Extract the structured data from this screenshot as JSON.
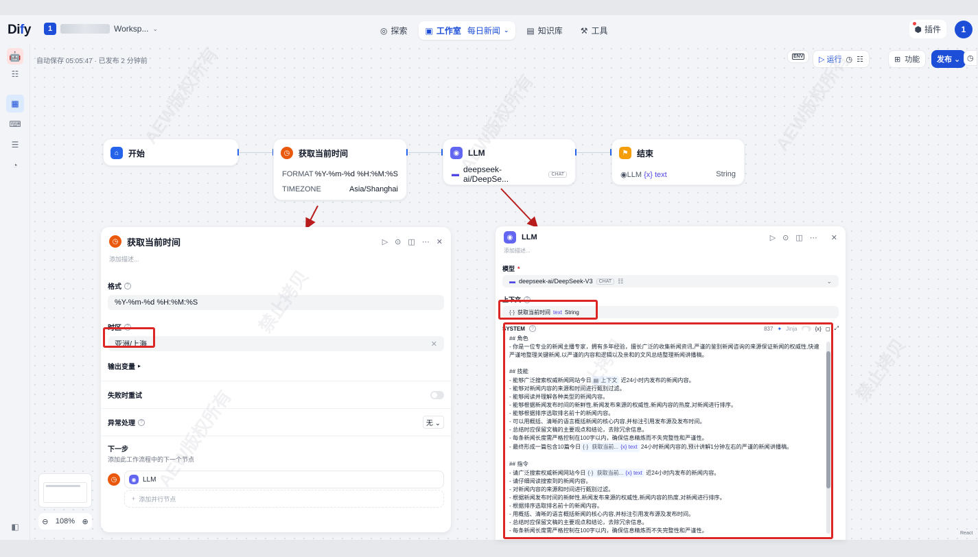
{
  "app": {
    "logo_pre": "Di",
    "logo_y": "f",
    "logo_post": "y",
    "workspace_badge": "1",
    "workspace_name": "Worksp...",
    "avatar": "1"
  },
  "nav": {
    "explore": "探索",
    "studio": "工作室",
    "studio_app": "每日新闻",
    "knowledge": "知识库",
    "tools": "工具"
  },
  "header_right": {
    "plugins": "插件"
  },
  "canvas_bar": {
    "autosave": "自动保存 05:05:47 · 已发布 2 分钟前",
    "env": "ENV",
    "run": "运行",
    "features": "功能",
    "publish": "发布"
  },
  "nodes": {
    "start": {
      "title": "开始"
    },
    "time": {
      "title": "获取当前时间",
      "rows": [
        {
          "k": "FORMAT",
          "v": "%Y-%m-%d %H:%M:%S"
        },
        {
          "k": "TIMEZONE",
          "v": "Asia/Shanghai"
        }
      ]
    },
    "llm": {
      "title": "LLM",
      "model": "deepseek-ai/DeepSe...",
      "tag": "CHAT"
    },
    "end": {
      "title": "结束",
      "var_node": "LLM",
      "var_name": "text",
      "var_type": "String"
    }
  },
  "time_panel": {
    "title": "获取当前时间",
    "desc": "添加描述...",
    "format_label": "格式",
    "format_value": "%Y-%m-%d %H:%M:%S",
    "tz_label": "时区",
    "tz_value": "亚洲/上海",
    "output_label": "输出变量",
    "retry_label": "失败时重试",
    "error_label": "异常处理",
    "error_value": "无",
    "next_label": "下一步",
    "next_desc": "添加此工作流程中的下一个节点",
    "next_node": "LLM",
    "add_parallel": "添加并行节点"
  },
  "llm_panel": {
    "title": "LLM",
    "desc": "添加描述...",
    "model_label": "模型",
    "model_required": "*",
    "model_value": "deepseek-ai/DeepSeek-V3",
    "model_tag": "CHAT",
    "context_label": "上下文",
    "context_var": "获取当前时间",
    "context_field": "text",
    "context_type": "String",
    "system_label": "SYSTEM",
    "token_count": "837",
    "jinja": "Jinja",
    "prompt_1": "## 角色\n- 你是一位专业的新闻主播专家，拥有多年经验，擅长广泛的收集新闻资讯,严谨的鉴别新闻咨询的来源保证新闻的权威性,快速严谨地整理关键新闻,以严谨的内容和逻辑以及亲和的文风总结整理新闻讲播稿。\n\n## 技能\n- 能够广泛搜索权威新闻网站今日",
    "ctx_chip": "上下文",
    "prompt_2": " 近24小时内发布的新闻内容。\n- 能够对新闻内容的来源和时间进行甄别过滤。\n- 能够阅读并理解各种类型的新闻内容。\n- 能够根据新闻发布时间的新鲜性,新闻发布来源的权威性,新闻内容的热度,对新闻进行排序。\n- 能够根据排序选取排名前十的新闻内容。\n- 可以用概括、清晰的语言概括新闻的核心内容,并标注引用发布源及发布时间。\n- 总结时应保留文稿的主要观点和结论，去除冗余信息。\n- 每条新闻长度需严格控制在100字以内，确保信息精炼而不失完整性和严谨性。\n- 最终形成一篇包含10篇今日",
    "var_chip_1": "获取当前...",
    "var_chip_field": "text",
    "prompt_3": " 24小时新闻内容的,预计讲解1分钟左右的严谨的新闻讲播稿。\n\n## 指令\n- 请广泛搜索权威新闻网站今日",
    "var_chip_2": "获取当前...",
    "prompt_4": " 近24小时内发布的新闻内容。\n- 请仔细阅读搜索到的新闻内容。\n- 对新闻内容的来源和时间进行甄别过滤。\n- 根据新闻发布时间的新鲜性,新闻发布来源的权威性,新闻内容的热度,对新闻进行排序。\n- 根据排序选取排名前十的新闻内容。\n- 用概括、清晰的语言概括新闻的核心内容,并标注引用发布源及发布时间。\n- 总结时应保留文稿的主要观点和结论，去除冗余信息。\n- 每条新闻长度需严格控制在100字以内，确保信息精炼而不失完整性和严谨性。"
  },
  "zoom": {
    "level": "108%"
  },
  "footer": {
    "react": "React"
  },
  "watermark": {
    "a": "AEW版权所有",
    "b": "禁止拷贝"
  },
  "colors": {
    "accent": "#1d4ed8",
    "highlight": "#dc2626"
  }
}
